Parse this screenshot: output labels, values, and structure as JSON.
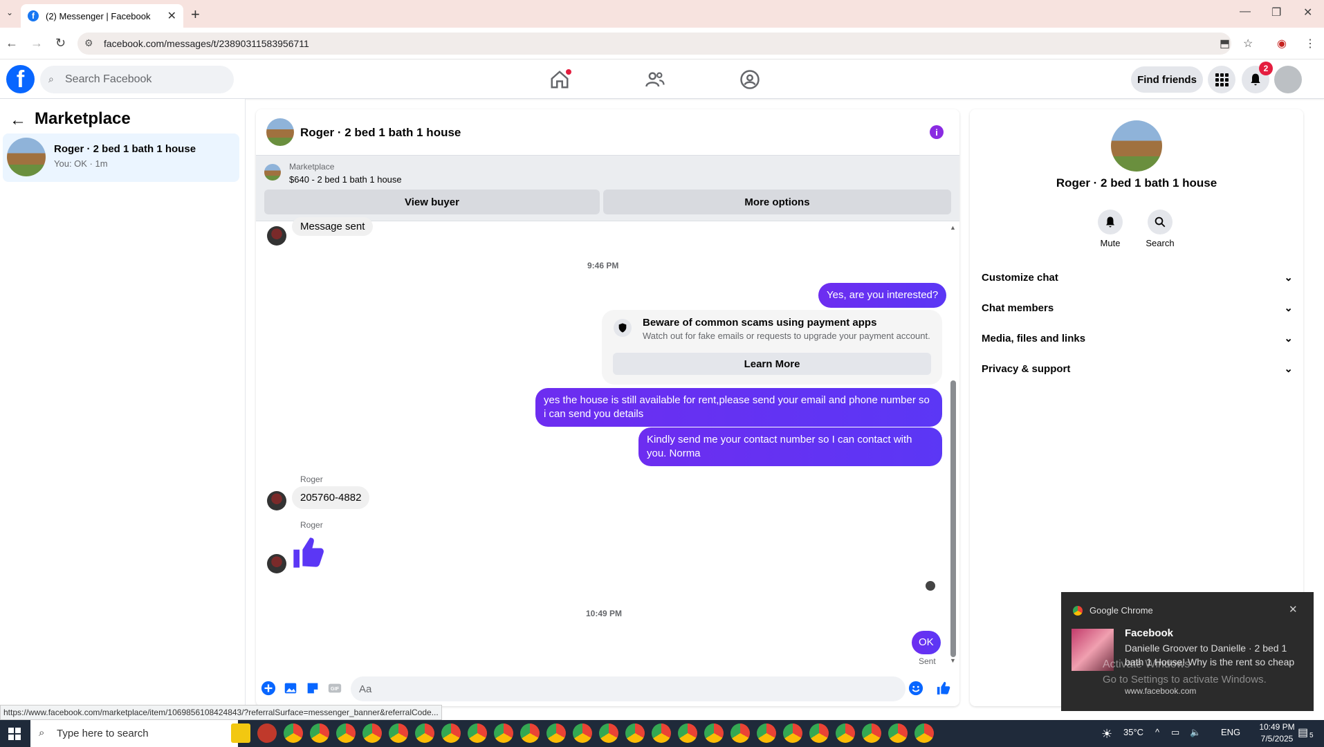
{
  "browser": {
    "tab_title": "(2) Messenger | Facebook",
    "url": "facebook.com/messages/t/23890311583956711",
    "status_url": "https://www.facebook.com/marketplace/item/1069856108424843/?referralSurface=messenger_banner&referralCode..."
  },
  "fb": {
    "search_placeholder": "Search Facebook",
    "find_friends": "Find friends",
    "notification_count": "2"
  },
  "left": {
    "title": "Marketplace",
    "item_name": "Roger · 2 bed 1 bath 1 house",
    "item_sub": "You: OK · 1m"
  },
  "chat": {
    "header_name": "Roger · 2 bed 1 bath 1 house",
    "banner_label": "Marketplace",
    "banner_price": "$640 - 2 bed 1 bath 1 house",
    "view_buyer": "View buyer",
    "more_options": "More options",
    "msg_sent": "Message sent",
    "ts1": "9:46 PM",
    "out1": "Yes, are you interested?",
    "scam_title": "Beware of common scams using payment apps",
    "scam_sub": "Watch out for fake emails or requests to upgrade your payment account.",
    "scam_btn": "Learn More",
    "out2": "yes the house is still available for rent,please send your email and phone number so i can send you details",
    "out3": "Kindly send me your contact number so I can contact with you. Norma",
    "sender": "Roger",
    "in_phone": "205760-4882",
    "ts2": "10:49 PM",
    "out_ok": "OK",
    "sent": "Sent",
    "composer_placeholder": "Aa"
  },
  "right": {
    "name": "Roger · 2 bed 1 bath 1 house",
    "mute": "Mute",
    "search": "Search",
    "rows": [
      "Customize chat",
      "Chat members",
      "Media, files and links",
      "Privacy & support"
    ]
  },
  "notification": {
    "app": "Google Chrome",
    "title": "Facebook",
    "body": "Danielle Groover to Danielle · 2 bed 1 bath 1 House! Why is the rent so cheap",
    "url": "www.facebook.com",
    "watermark1": "Activate Windows",
    "watermark2": "Go to Settings to activate Windows."
  },
  "taskbar": {
    "search_placeholder": "Type here to search",
    "temp": "35°C",
    "lang": "ENG",
    "time": "10:49 PM",
    "date": "7/5/2025",
    "notif_count": "5"
  },
  "colors": {
    "fb_blue": "#0866ff",
    "outgoing_bubble": "#5b37f5",
    "tab_strip": "#f7e3df"
  }
}
